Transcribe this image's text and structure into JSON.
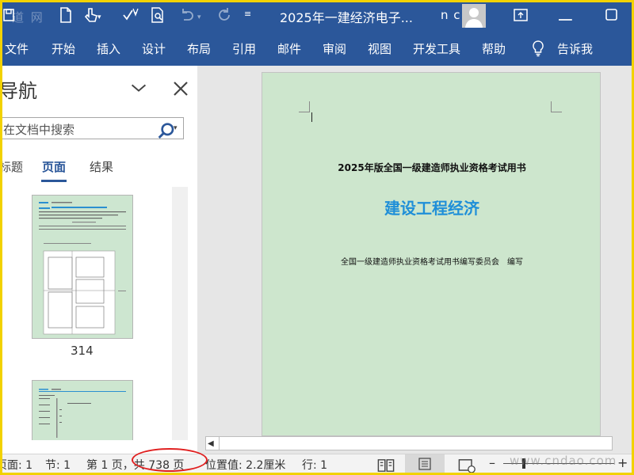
{
  "window": {
    "title": "2025年一建经济电子...",
    "user": "n c",
    "watermark_top": "道 网",
    "watermark_bottom": "www.cndao.com"
  },
  "ribbon": {
    "tabs": [
      "文件",
      "开始",
      "插入",
      "设计",
      "布局",
      "引用",
      "邮件",
      "审阅",
      "视图",
      "开发工具",
      "帮助",
      "告诉我"
    ]
  },
  "nav": {
    "title": "导航",
    "search_text": "在文档中搜索",
    "tabs": [
      "标题",
      "页面",
      "结果"
    ],
    "thumb_page_number": "314"
  },
  "document": {
    "line1": "2025年版全国一级建造师执业资格考试用书",
    "line2": "建设工程经济",
    "line3": "全国一级建造师执业资格考试用书编写委员会　编写"
  },
  "status": {
    "section_page": "页面: 1",
    "section": "节: 1",
    "page_of": "第 1 页，共 738 页",
    "position": "位置值: 2.2厘米",
    "line": "行: 1"
  },
  "colors": {
    "ribbon": "#2b579a",
    "page": "#cde6cd",
    "heading": "#1f8fd8",
    "highlight_circle": "#e02020"
  }
}
